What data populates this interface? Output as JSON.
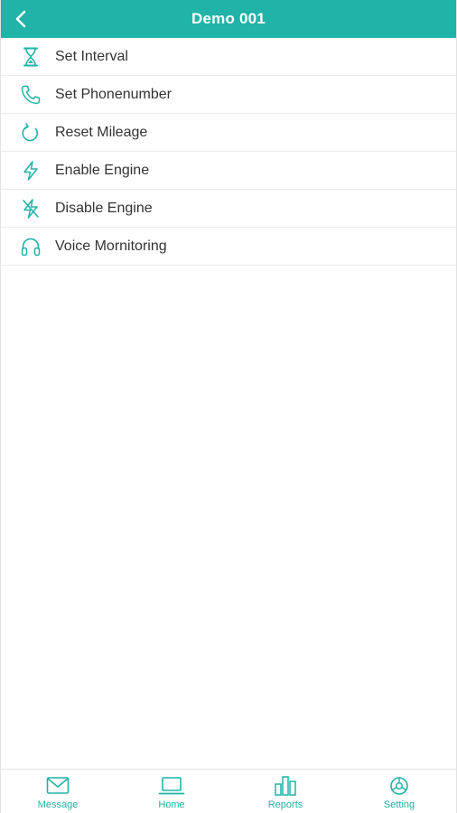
{
  "header": {
    "title": "Demo 001",
    "back_icon": "chevron-left-icon",
    "background_color": "#20b3a8"
  },
  "menu": {
    "items": [
      {
        "label": "Set Interval",
        "icon": "hourglass-icon"
      },
      {
        "label": "Set Phonenumber",
        "icon": "phone-icon"
      },
      {
        "label": "Reset Mileage",
        "icon": "refresh-icon"
      },
      {
        "label": "Enable Engine",
        "icon": "lightning-icon"
      },
      {
        "label": "Disable Engine",
        "icon": "lightning-off-icon"
      },
      {
        "label": "Voice Mornitoring",
        "icon": "headphones-icon"
      }
    ]
  },
  "tabbar": {
    "accent_color": "#20b3a8",
    "tabs": [
      {
        "label": "Message",
        "icon": "envelope-icon"
      },
      {
        "label": "Home",
        "icon": "laptop-icon"
      },
      {
        "label": "Reports",
        "icon": "bar-chart-icon"
      },
      {
        "label": "Setting",
        "icon": "gear-icon"
      }
    ]
  }
}
